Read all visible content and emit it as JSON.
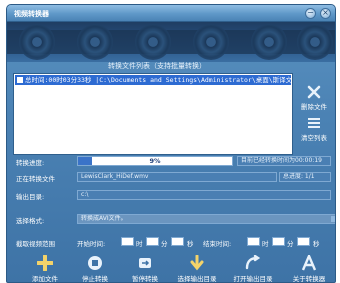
{
  "window": {
    "title": "视频转换器",
    "minimize": "−",
    "close": "×"
  },
  "file_list": {
    "caption": "转换文件列表（支持批量转换）",
    "items": [
      {
        "text": "总时间:00时03分33秒 |C:\\Documents and Settings\\Administrator\\桌面\\斯译文"
      }
    ]
  },
  "side_buttons": {
    "delete_label": "删除文件",
    "clear_label": "清空列表"
  },
  "progress": {
    "label": "转换进度:",
    "percent": 9,
    "percent_text": "9%",
    "elapsed_text": "目前已经转换时间为00:00:19"
  },
  "current": {
    "label": "正在转换文件",
    "file": "LewisClark_HiDef.wmv",
    "total_progress": "总进度: 1/1"
  },
  "output": {
    "label": "输出目录:",
    "value": "c:\\"
  },
  "format": {
    "label": "选择格式:",
    "value": "转换成AVI文件。"
  },
  "range": {
    "label": "截取视频范围",
    "start_label": "开始时间:",
    "end_label": "结束时间:",
    "hour": "时",
    "minute": "分",
    "second": "秒"
  },
  "toolbar": {
    "add": "添加文件",
    "stop": "停止转换",
    "start": "暂停转换",
    "choose_output": "选择输出目录",
    "open_output": "打开输出目录",
    "about": "关于转换器"
  },
  "colors": {
    "window_bg": "#4b82b4",
    "selection": "#2d6bd2",
    "progress_fill": "#3a73c8"
  }
}
